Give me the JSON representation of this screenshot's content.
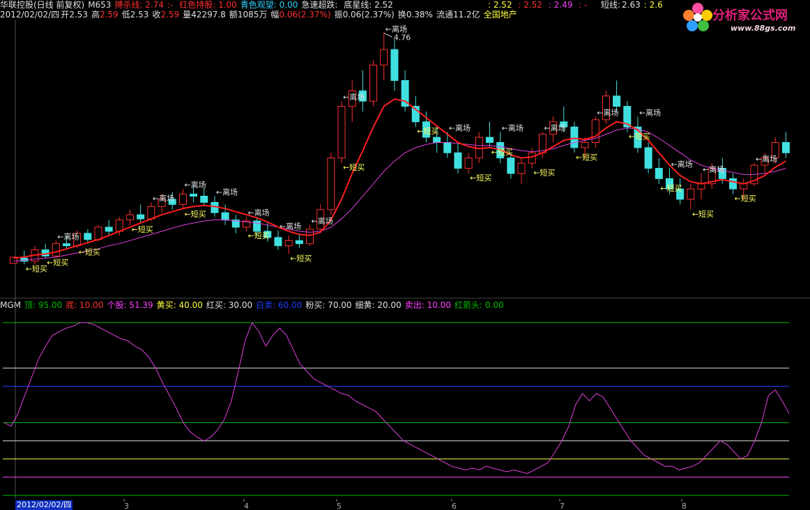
{
  "header": {
    "stock_name": "华联控股(日线 前复权)",
    "indicator_code": "M653",
    "fields": [
      {
        "label": "搏杀线:",
        "value": "2.74",
        "color": "#ff3030"
      },
      {
        "label": ":-",
        "value": "",
        "color": "#ff3030"
      },
      {
        "label": "红色持股:",
        "value": "1.00",
        "color": "#ff3030"
      },
      {
        "label": "青色观望:",
        "value": "0.00",
        "color": "#30d0ff"
      },
      {
        "label": "急速超跌:",
        "value": "",
        "color": "#e0e0e0"
      },
      {
        "label": "底星线:",
        "value": "2.52",
        "color": "#e0e0e0"
      }
    ],
    "right_values": [
      ": 2.52",
      ": 2.52",
      ": 2.49",
      ": -"
    ],
    "short_line_label": "短线:",
    "short_line_value": "2.63",
    "short_line_tail": ": 2.6"
  },
  "quote": {
    "date": "2012/02/02/四",
    "open_label": "开",
    "open": "2.53",
    "high_label": "高",
    "high": "2.59",
    "low_label": "低",
    "low": "2.53",
    "close_label": "收",
    "close": "2.59",
    "volume_label": "量",
    "volume": "42297.8",
    "amount_label": "额",
    "amount": "1085万",
    "change_label": "幅",
    "change": "0.06(2.37%)",
    "amplitude_label": "振",
    "amplitude": "0.06(2.37%)",
    "turnover_label": "换",
    "turnover": "0.38%",
    "float_label": "流通",
    "float": "11.2亿",
    "sector": "全国地产"
  },
  "logo": {
    "text": "分析家公式网",
    "url": "www.88gs.com"
  },
  "indicator_header": {
    "name": "MGM",
    "fields": [
      {
        "label": "顶:",
        "value": "95.00",
        "color": "#00c000"
      },
      {
        "label": "底:",
        "value": "10.00",
        "color": "#ff3030"
      },
      {
        "label": "个股:",
        "value": "51.39",
        "color": "#ff40ff"
      },
      {
        "label": "黄买:",
        "value": "40.00",
        "color": "#ffff40"
      },
      {
        "label": "红买:",
        "value": "30.00",
        "color": "#e0e0e0"
      },
      {
        "label": "白卖:",
        "value": "60.00",
        "color": "#2040ff"
      },
      {
        "label": "粉买:",
        "value": "70.00",
        "color": "#e0e0e0"
      },
      {
        "label": "细黄:",
        "value": "20.00",
        "color": "#e0e0e0"
      },
      {
        "label": "卖出:",
        "value": "10.00",
        "color": "#ff40ff"
      },
      {
        "label": "红箭头:",
        "value": "0.00",
        "color": "#00c000"
      }
    ]
  },
  "chart_data": [
    {
      "type": "candlestick",
      "title": "华联控股(日线 前复权)",
      "high_annotation": "4.76",
      "annotations": {
        "exit": "←离场",
        "short_buy": "←短买"
      },
      "x_ticks": [
        "2012/02/02/四",
        "3",
        "4",
        "5",
        "6",
        "7",
        "8"
      ],
      "ohlc": [
        [
          2.53,
          2.59,
          2.53,
          2.59
        ],
        [
          2.58,
          2.65,
          2.52,
          2.55
        ],
        [
          2.55,
          2.7,
          2.52,
          2.66
        ],
        [
          2.66,
          2.72,
          2.58,
          2.6
        ],
        [
          2.6,
          2.75,
          2.58,
          2.72
        ],
        [
          2.72,
          2.8,
          2.66,
          2.7
        ],
        [
          2.7,
          2.85,
          2.68,
          2.82
        ],
        [
          2.82,
          2.86,
          2.72,
          2.76
        ],
        [
          2.76,
          2.9,
          2.74,
          2.88
        ],
        [
          2.88,
          2.95,
          2.8,
          2.84
        ],
        [
          2.84,
          2.98,
          2.8,
          2.95
        ],
        [
          2.95,
          3.05,
          2.9,
          3.0
        ],
        [
          3.0,
          3.1,
          2.92,
          2.96
        ],
        [
          2.96,
          3.12,
          2.94,
          3.08
        ],
        [
          3.08,
          3.2,
          3.02,
          3.15
        ],
        [
          3.15,
          3.22,
          3.05,
          3.1
        ],
        [
          3.1,
          3.25,
          3.05,
          3.2
        ],
        [
          3.2,
          3.28,
          3.12,
          3.18
        ],
        [
          3.18,
          3.26,
          3.08,
          3.12
        ],
        [
          3.12,
          3.18,
          2.98,
          3.02
        ],
        [
          3.02,
          3.1,
          2.9,
          2.95
        ],
        [
          2.95,
          3.0,
          2.82,
          2.88
        ],
        [
          2.88,
          2.98,
          2.84,
          2.94
        ],
        [
          2.94,
          2.98,
          2.8,
          2.84
        ],
        [
          2.84,
          2.92,
          2.74,
          2.78
        ],
        [
          2.78,
          2.85,
          2.66,
          2.7
        ],
        [
          2.7,
          2.8,
          2.62,
          2.75
        ],
        [
          2.75,
          2.82,
          2.68,
          2.72
        ],
        [
          2.72,
          2.9,
          2.7,
          2.86
        ],
        [
          2.86,
          3.1,
          2.84,
          3.05
        ],
        [
          3.05,
          3.6,
          3.0,
          3.55
        ],
        [
          3.55,
          4.1,
          3.5,
          4.05
        ],
        [
          4.05,
          4.3,
          3.9,
          4.2
        ],
        [
          4.2,
          4.4,
          4.0,
          4.1
        ],
        [
          4.1,
          4.5,
          4.05,
          4.45
        ],
        [
          4.45,
          4.76,
          4.3,
          4.6
        ],
        [
          4.6,
          4.7,
          4.2,
          4.3
        ],
        [
          4.3,
          4.4,
          4.0,
          4.05
        ],
        [
          4.05,
          4.15,
          3.85,
          3.9
        ],
        [
          3.9,
          4.0,
          3.7,
          3.75
        ],
        [
          3.75,
          3.85,
          3.6,
          3.7
        ],
        [
          3.7,
          3.8,
          3.55,
          3.6
        ],
        [
          3.6,
          3.7,
          3.4,
          3.45
        ],
        [
          3.45,
          3.6,
          3.4,
          3.55
        ],
        [
          3.55,
          3.8,
          3.5,
          3.75
        ],
        [
          3.75,
          3.9,
          3.65,
          3.7
        ],
        [
          3.7,
          3.8,
          3.5,
          3.55
        ],
        [
          3.55,
          3.6,
          3.35,
          3.4
        ],
        [
          3.4,
          3.55,
          3.3,
          3.5
        ],
        [
          3.5,
          3.65,
          3.45,
          3.6
        ],
        [
          3.6,
          3.8,
          3.55,
          3.78
        ],
        [
          3.78,
          3.95,
          3.7,
          3.9
        ],
        [
          3.9,
          4.05,
          3.8,
          3.85
        ],
        [
          3.85,
          3.9,
          3.6,
          3.65
        ],
        [
          3.65,
          3.75,
          3.55,
          3.7
        ],
        [
          3.7,
          3.95,
          3.65,
          3.92
        ],
        [
          3.92,
          4.2,
          3.88,
          4.15
        ],
        [
          4.15,
          4.3,
          4.0,
          4.05
        ],
        [
          4.05,
          4.1,
          3.8,
          3.85
        ],
        [
          3.85,
          3.95,
          3.6,
          3.65
        ],
        [
          3.65,
          3.7,
          3.4,
          3.45
        ],
        [
          3.45,
          3.55,
          3.3,
          3.35
        ],
        [
          3.35,
          3.45,
          3.2,
          3.25
        ],
        [
          3.25,
          3.35,
          3.1,
          3.15
        ],
        [
          3.15,
          3.3,
          3.05,
          3.25
        ],
        [
          3.25,
          3.4,
          3.15,
          3.3
        ],
        [
          3.3,
          3.5,
          3.25,
          3.45
        ],
        [
          3.45,
          3.55,
          3.3,
          3.35
        ],
        [
          3.35,
          3.4,
          3.2,
          3.25
        ],
        [
          3.25,
          3.35,
          3.15,
          3.3
        ],
        [
          3.3,
          3.5,
          3.28,
          3.48
        ],
        [
          3.48,
          3.6,
          3.4,
          3.55
        ],
        [
          3.55,
          3.75,
          3.5,
          3.7
        ],
        [
          3.7,
          3.8,
          3.55,
          3.6
        ]
      ],
      "ma_fast": [
        2.58,
        2.59,
        2.61,
        2.62,
        2.64,
        2.67,
        2.7,
        2.73,
        2.76,
        2.8,
        2.84,
        2.88,
        2.92,
        2.96,
        3.0,
        3.03,
        3.06,
        3.08,
        3.09,
        3.08,
        3.06,
        3.03,
        3.0,
        2.97,
        2.93,
        2.88,
        2.84,
        2.81,
        2.8,
        2.83,
        2.95,
        3.15,
        3.4,
        3.62,
        3.85,
        4.05,
        4.12,
        4.1,
        4.02,
        3.94,
        3.86,
        3.78,
        3.7,
        3.66,
        3.64,
        3.65,
        3.63,
        3.58,
        3.55,
        3.56,
        3.6,
        3.66,
        3.72,
        3.74,
        3.73,
        3.76,
        3.84,
        3.9,
        3.88,
        3.82,
        3.72,
        3.6,
        3.48,
        3.38,
        3.32,
        3.3,
        3.32,
        3.34,
        3.32,
        3.3,
        3.33,
        3.38,
        3.46,
        3.52
      ],
      "ma_slow": [
        2.55,
        2.56,
        2.57,
        2.58,
        2.59,
        2.61,
        2.63,
        2.65,
        2.67,
        2.7,
        2.72,
        2.75,
        2.78,
        2.81,
        2.84,
        2.87,
        2.9,
        2.92,
        2.94,
        2.95,
        2.95,
        2.94,
        2.93,
        2.92,
        2.9,
        2.88,
        2.86,
        2.84,
        2.83,
        2.84,
        2.88,
        2.96,
        3.06,
        3.18,
        3.3,
        3.42,
        3.52,
        3.6,
        3.65,
        3.68,
        3.7,
        3.7,
        3.69,
        3.68,
        3.67,
        3.67,
        3.66,
        3.64,
        3.62,
        3.61,
        3.62,
        3.64,
        3.67,
        3.7,
        3.72,
        3.74,
        3.78,
        3.82,
        3.84,
        3.83,
        3.8,
        3.74,
        3.67,
        3.6,
        3.53,
        3.48,
        3.45,
        3.43,
        3.41,
        3.39,
        3.39,
        3.4,
        3.42,
        3.45
      ]
    },
    {
      "type": "line",
      "title": "MGM",
      "x_ticks": [
        "2012/02/02/四",
        "3",
        "4",
        "5",
        "6",
        "7",
        "8"
      ],
      "reference_lines": [
        {
          "name": "顶",
          "value": 95,
          "color": "#00c000"
        },
        {
          "name": "粉买",
          "value": 70,
          "color": "#e0e0e0"
        },
        {
          "name": "白卖",
          "value": 60,
          "color": "#2040ff"
        },
        {
          "name": "黄买",
          "value": 40,
          "color": "#00c000"
        },
        {
          "name": "红买",
          "value": 30,
          "color": "#e0e0e0"
        },
        {
          "name": "细黄",
          "value": 20,
          "color": "#ffff40"
        },
        {
          "name": "卖出",
          "value": 10,
          "color": "#ff40ff"
        },
        {
          "name": "底",
          "value": 0,
          "color": "#00c000"
        }
      ],
      "series": [
        {
          "name": "个股",
          "color": "#e040e0",
          "values": [
            40,
            38,
            45,
            55,
            65,
            75,
            82,
            88,
            90,
            92,
            93,
            95,
            95,
            94,
            92,
            90,
            88,
            86,
            85,
            82,
            80,
            76,
            70,
            62,
            55,
            48,
            40,
            35,
            32,
            30,
            32,
            36,
            42,
            52,
            68,
            85,
            95,
            90,
            82,
            88,
            92,
            88,
            80,
            72,
            68,
            64,
            62,
            60,
            58,
            56,
            55,
            52,
            50,
            48,
            46,
            42,
            38,
            34,
            30,
            28,
            26,
            24,
            22,
            20,
            18,
            16,
            15,
            14,
            15,
            14,
            16,
            15,
            14,
            13,
            14,
            13,
            12,
            14,
            16,
            18,
            24,
            30,
            38,
            50,
            56,
            52,
            56,
            54,
            48,
            42,
            36,
            30,
            26,
            22,
            20,
            18,
            16,
            16,
            14,
            15,
            16,
            18,
            22,
            26,
            30,
            28,
            24,
            20,
            22,
            30,
            40,
            55,
            58,
            52,
            45
          ]
        }
      ],
      "ylim": [
        0,
        100
      ]
    }
  ]
}
